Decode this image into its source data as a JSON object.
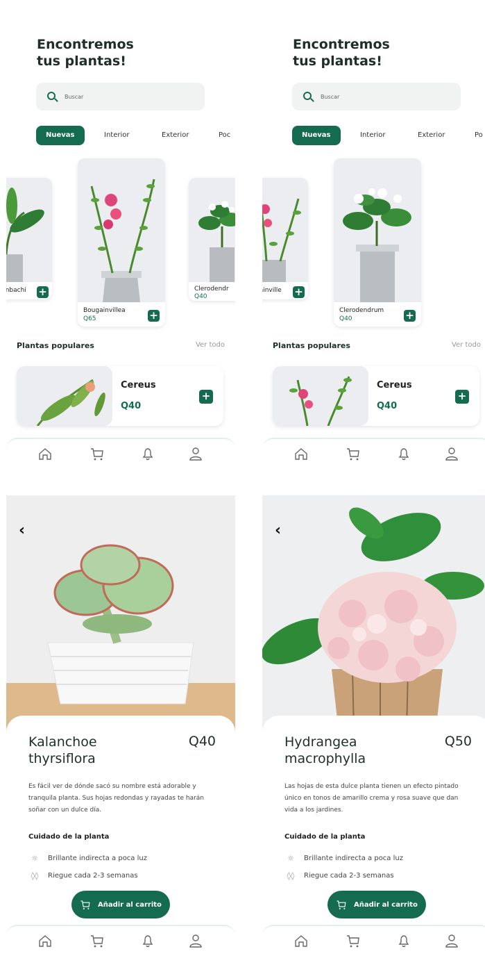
{
  "home": {
    "title_line1": "Encontremos",
    "title_line2": "tus plantas!",
    "search_placeholder": "Buscar",
    "tabs": [
      "Nuevas",
      "Interior",
      "Exterior",
      "Poc"
    ],
    "tabs_s2_last": "Po",
    "section_title": "Plantas populares",
    "see_all": "Ver todo",
    "popular": {
      "name": "Cereus",
      "price": "Q40"
    },
    "plus": "+"
  },
  "screen1": {
    "cards": [
      {
        "name": "fenbachi",
        "price": ""
      },
      {
        "name": "Bougainvillea",
        "price": "Q65"
      },
      {
        "name": "Clerodendr",
        "price": "Q40"
      }
    ]
  },
  "screen2": {
    "cards": [
      {
        "name": "gainville",
        "price": ""
      },
      {
        "name": "Clerodendrum",
        "price": "Q40"
      }
    ]
  },
  "detail1": {
    "name_line1": "Kalanchoe",
    "name_line2": "thyrsiflora",
    "price": "Q40",
    "desc": "Es fácil ver de dónde sacó su nombre está adorable y tranquila planta. Sus hojas redondas y rayadas te harán soñar con un dulce día."
  },
  "detail2": {
    "name_line1": "Hydrangea",
    "name_line2": "macrophylla",
    "price": "Q50",
    "desc": "Las hojas de esta dulce planta tienen un efecto pintado único en tonos de amarillo crema y rosa suave que dan vida a los jardines."
  },
  "care": {
    "title": "Cuidado de la planta",
    "light": "Brillante indirecta a poca luz",
    "water": "Riegue cada 2-3 semanas"
  },
  "add_to_cart": "Añadir al carrito",
  "back": "‹",
  "colors": {
    "primary": "#146b50",
    "background": "#ffffff",
    "card_bg": "#ecedf0"
  },
  "icons": [
    "home-icon",
    "cart-icon",
    "bell-icon",
    "user-icon",
    "search-icon",
    "sun-icon",
    "water-drops-icon",
    "chevron-left-icon",
    "plus-icon"
  ]
}
